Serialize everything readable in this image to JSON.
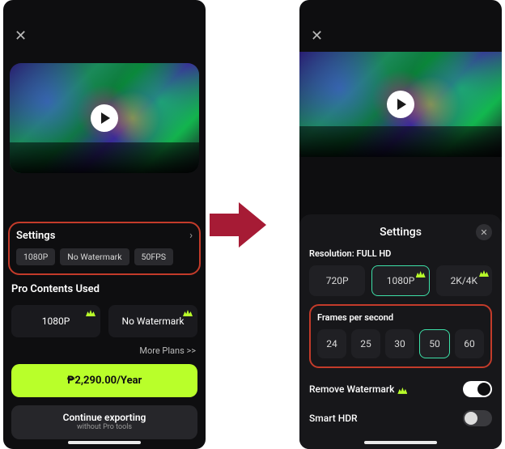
{
  "left": {
    "settings_label": "Settings",
    "chips": {
      "res": "1080P",
      "wm": "No Watermark",
      "fps": "50FPS"
    },
    "pro_section": "Pro Contents Used",
    "cards": {
      "res": "1080P",
      "wm": "No Watermark"
    },
    "more": "More Plans >>",
    "price": "₱2,290.00/Year",
    "continue": "Continue exporting",
    "continue_sub": "without Pro tools"
  },
  "right": {
    "sheet_title": "Settings",
    "res_label": "Resolution: FULL HD",
    "res_opts": {
      "a": "720P",
      "b": "1080P",
      "c": "2K/4K"
    },
    "fps_label": "Frames per second",
    "fps_opts": {
      "a": "24",
      "b": "25",
      "c": "30",
      "d": "50",
      "e": "60"
    },
    "rw_label": "Remove Watermark",
    "hdr_label": "Smart HDR"
  }
}
